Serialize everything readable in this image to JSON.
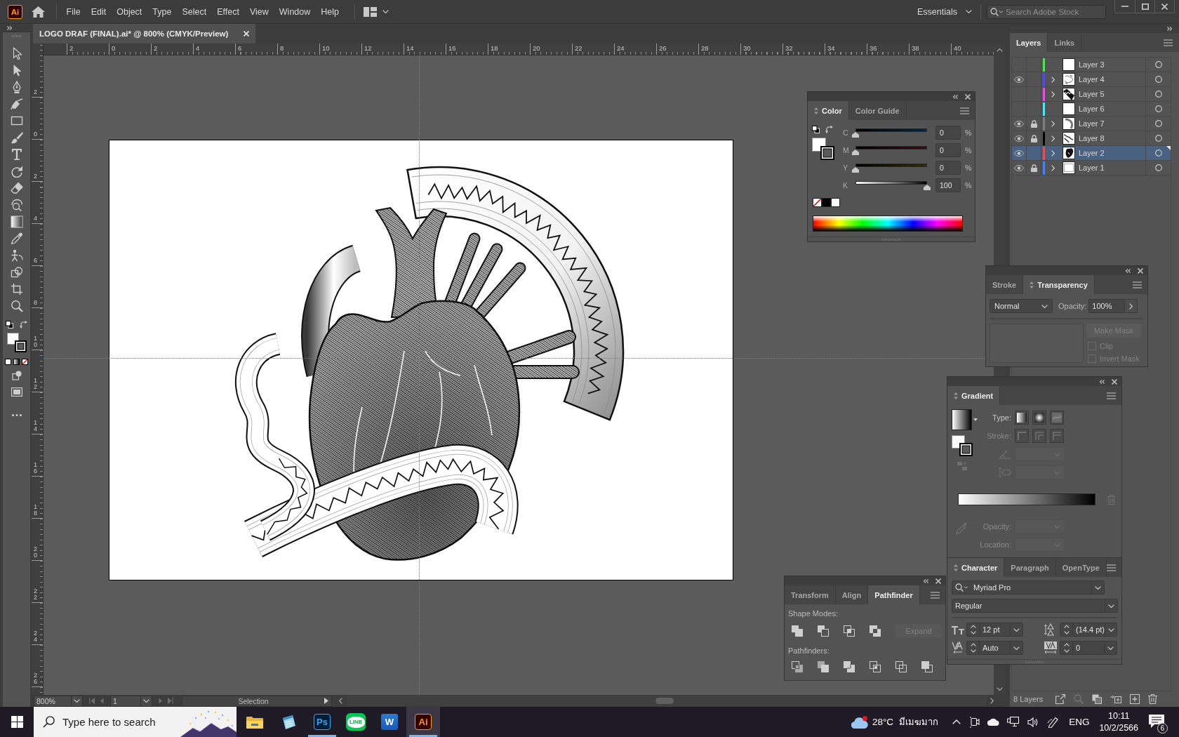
{
  "app_bar": {
    "logo": "Ai",
    "menu": [
      "File",
      "Edit",
      "Object",
      "Type",
      "Select",
      "Effect",
      "View",
      "Window",
      "Help"
    ],
    "workspace": "Essentials",
    "stock_search": {
      "placeholder": "Search Adobe Stock"
    }
  },
  "document_tab": {
    "title": "LOGO DRAF (FINAL).ai* @ 800% (CMYK/Preview)"
  },
  "rulers": {
    "horizontal": [
      "2",
      "0",
      "2",
      "4",
      "6",
      "8",
      "10",
      "12",
      "14",
      "16",
      "18",
      "20",
      "22",
      "24",
      "26",
      "28",
      "30",
      "32",
      "34",
      "36",
      "38",
      "40"
    ],
    "vertical": [
      "2",
      "0",
      "2",
      "4",
      "6",
      "8",
      "10",
      "12",
      "14",
      "16",
      "18",
      "20",
      "22",
      "24",
      "26"
    ]
  },
  "layers_panel": {
    "tabs": [
      {
        "label": "Layers",
        "selected": true
      },
      {
        "label": "Links",
        "selected": false
      }
    ],
    "layers": [
      {
        "name": "Layer 3",
        "visible": false,
        "locked": false,
        "color": "#4fe34f",
        "has_sublayers": false,
        "thumbnail": {
          "kind": "empty"
        },
        "selected": false
      },
      {
        "name": "Layer 4",
        "visible": true,
        "locked": false,
        "color": "#4f4fe8",
        "has_sublayers": true,
        "thumbnail": {
          "kind": "sketch"
        },
        "selected": false
      },
      {
        "name": "Layer 5",
        "visible": false,
        "locked": false,
        "color": "#e64fe6",
        "has_sublayers": true,
        "thumbnail": {
          "kind": "zigzag"
        },
        "selected": false
      },
      {
        "name": "Layer 6",
        "visible": false,
        "locked": false,
        "color": "#4fe6f0",
        "has_sublayers": false,
        "thumbnail": {
          "kind": "empty"
        },
        "selected": false
      },
      {
        "name": "Layer 7",
        "visible": true,
        "locked": true,
        "color": "#7f7f7f",
        "has_sublayers": true,
        "thumbnail": {
          "kind": "arc"
        },
        "selected": false
      },
      {
        "name": "Layer 8",
        "visible": true,
        "locked": true,
        "color": "#000000",
        "has_sublayers": true,
        "thumbnail": {
          "kind": "wave"
        },
        "selected": false
      },
      {
        "name": "Layer 2",
        "visible": true,
        "locked": false,
        "color": "#e84f4f",
        "has_sublayers": true,
        "thumbnail": {
          "kind": "heart"
        },
        "selected": true
      },
      {
        "name": "Layer 1",
        "visible": true,
        "locked": true,
        "color": "#4f7fee",
        "has_sublayers": true,
        "thumbnail": {
          "kind": "frame"
        },
        "selected": false
      }
    ],
    "count": "8 Layers"
  },
  "color_panel": {
    "tabs": [
      {
        "label": "Color",
        "selected": true
      },
      {
        "label": "Color Guide",
        "selected": false
      }
    ],
    "channels": [
      {
        "name": "C",
        "level": 0,
        "value": "0",
        "unit": "%"
      },
      {
        "name": "M",
        "level": 0,
        "value": "0",
        "unit": "%"
      },
      {
        "name": "Y",
        "level": 0,
        "value": "0",
        "unit": "%"
      },
      {
        "name": "K",
        "level": 1,
        "value": "100",
        "unit": "%"
      }
    ]
  },
  "transparency_panel": {
    "tabs": [
      {
        "label": "Stroke",
        "selected": false
      },
      {
        "label": "Transparency",
        "selected": true
      }
    ],
    "blend_mode": "Normal",
    "opacity_label": "Opacity:",
    "opacity": "100%",
    "make_mask": {
      "label": "Make Mask",
      "disabled": true
    },
    "options": [
      {
        "label": "Clip",
        "checked": false,
        "disabled": true
      },
      {
        "label": "Invert Mask",
        "checked": false,
        "disabled": true
      }
    ]
  },
  "gradient_panel": {
    "tabs": [
      {
        "label": "Gradient",
        "selected": true
      }
    ],
    "type_label": "Type:",
    "stroke_label": "Stroke:",
    "opacity_label": "Opacity:",
    "location_label": "Location:",
    "disabled": true
  },
  "character_panel": {
    "tabs": [
      {
        "label": "Character",
        "selected": true
      },
      {
        "label": "Paragraph",
        "selected": false
      },
      {
        "label": "OpenType",
        "selected": false
      }
    ],
    "font": "Myriad Pro",
    "style": "Regular",
    "size": "12 pt",
    "leading": "(14.4 pt)",
    "kerning": "Auto",
    "tracking": "0"
  },
  "pathfinder_panel": {
    "tabs": [
      {
        "label": "Transform",
        "selected": false
      },
      {
        "label": "Align",
        "selected": false
      },
      {
        "label": "Pathfinder",
        "selected": true
      }
    ],
    "shape_modes_label": "Shape Modes:",
    "expand": {
      "label": "Expand",
      "disabled": true
    },
    "pathfinders_label": "Pathfinders:"
  },
  "status_bar": {
    "zoom": "800%",
    "artboard": "1",
    "info": "Selection"
  },
  "taskbar": {
    "search": {
      "placeholder": "Type here to search"
    },
    "apps": [
      {
        "kind": "explorer",
        "running": false,
        "active": false
      },
      {
        "kind": "notepad",
        "running": false,
        "active": false
      },
      {
        "kind": "photoshop",
        "label": "Ps",
        "running": true,
        "active": false
      },
      {
        "kind": "line",
        "label": "LINE",
        "running": false,
        "active": false
      },
      {
        "kind": "word",
        "label": "W",
        "running": false,
        "active": false
      },
      {
        "kind": "illustrator",
        "label": "Ai",
        "running": true,
        "active": true
      }
    ],
    "weather": {
      "temperature": "28°C",
      "condition": "มีเมฆมาก"
    },
    "language": "ENG",
    "time": "10:11",
    "date": "10/2/2566",
    "notifications": "6"
  }
}
